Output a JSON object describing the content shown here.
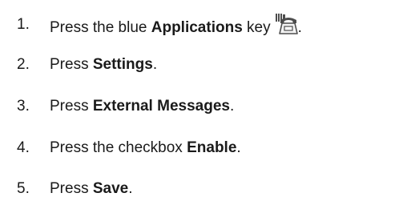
{
  "steps": [
    {
      "number": "1.",
      "before": "Press the blue ",
      "bold": "Applications",
      "after_bold": " key",
      "icon": "applications-key-icon",
      "end": "."
    },
    {
      "number": "2.",
      "before": "Press ",
      "bold": "Settings",
      "end": "."
    },
    {
      "number": "3.",
      "before": "Press ",
      "bold": "External Messages",
      "end": "."
    },
    {
      "number": "4.",
      "before": "Press the checkbox ",
      "bold": "Enable",
      "end": "."
    },
    {
      "number": "5.",
      "before": "Press ",
      "bold": "Save",
      "end": "."
    }
  ],
  "colors": {
    "text": "#1a1a1a",
    "background": "#ffffff",
    "icon": "#4d4d4d"
  }
}
